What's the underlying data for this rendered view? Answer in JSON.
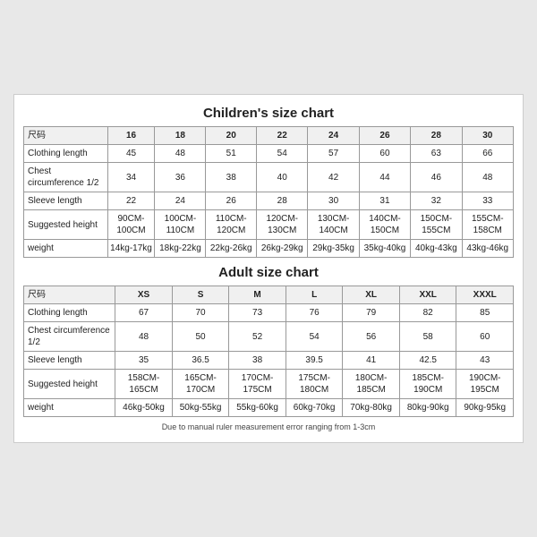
{
  "children_chart": {
    "title": "Children's size chart",
    "columns": [
      "尺码",
      "16",
      "18",
      "20",
      "22",
      "24",
      "26",
      "28",
      "30"
    ],
    "rows": [
      {
        "label": "Clothing length",
        "values": [
          "45",
          "48",
          "51",
          "54",
          "57",
          "60",
          "63",
          "66"
        ]
      },
      {
        "label": "Chest circumference 1/2",
        "values": [
          "34",
          "36",
          "38",
          "40",
          "42",
          "44",
          "46",
          "48"
        ]
      },
      {
        "label": "Sleeve length",
        "values": [
          "22",
          "24",
          "26",
          "28",
          "30",
          "31",
          "32",
          "33"
        ]
      },
      {
        "label": "Suggested height",
        "values": [
          "90CM-100CM",
          "100CM-110CM",
          "110CM-120CM",
          "120CM-130CM",
          "130CM-140CM",
          "140CM-150CM",
          "150CM-155CM",
          "155CM-158CM"
        ]
      },
      {
        "label": "weight",
        "values": [
          "14kg-17kg",
          "18kg-22kg",
          "22kg-26kg",
          "26kg-29kg",
          "29kg-35kg",
          "35kg-40kg",
          "40kg-43kg",
          "43kg-46kg"
        ]
      }
    ]
  },
  "adult_chart": {
    "title": "Adult size chart",
    "columns": [
      "尺码",
      "XS",
      "S",
      "M",
      "L",
      "XL",
      "XXL",
      "XXXL"
    ],
    "rows": [
      {
        "label": "Clothing length",
        "values": [
          "67",
          "70",
          "73",
          "76",
          "79",
          "82",
          "85"
        ]
      },
      {
        "label": "Chest circumference 1/2",
        "values": [
          "48",
          "50",
          "52",
          "54",
          "56",
          "58",
          "60"
        ]
      },
      {
        "label": "Sleeve length",
        "values": [
          "35",
          "36.5",
          "38",
          "39.5",
          "41",
          "42.5",
          "43"
        ]
      },
      {
        "label": "Suggested height",
        "values": [
          "158CM-165CM",
          "165CM-170CM",
          "170CM-175CM",
          "175CM-180CM",
          "180CM-185CM",
          "185CM-190CM",
          "190CM-195CM"
        ]
      },
      {
        "label": "weight",
        "values": [
          "46kg-50kg",
          "50kg-55kg",
          "55kg-60kg",
          "60kg-70kg",
          "70kg-80kg",
          "80kg-90kg",
          "90kg-95kg"
        ]
      }
    ]
  },
  "note": "Due to manual ruler measurement error ranging from 1-3cm"
}
